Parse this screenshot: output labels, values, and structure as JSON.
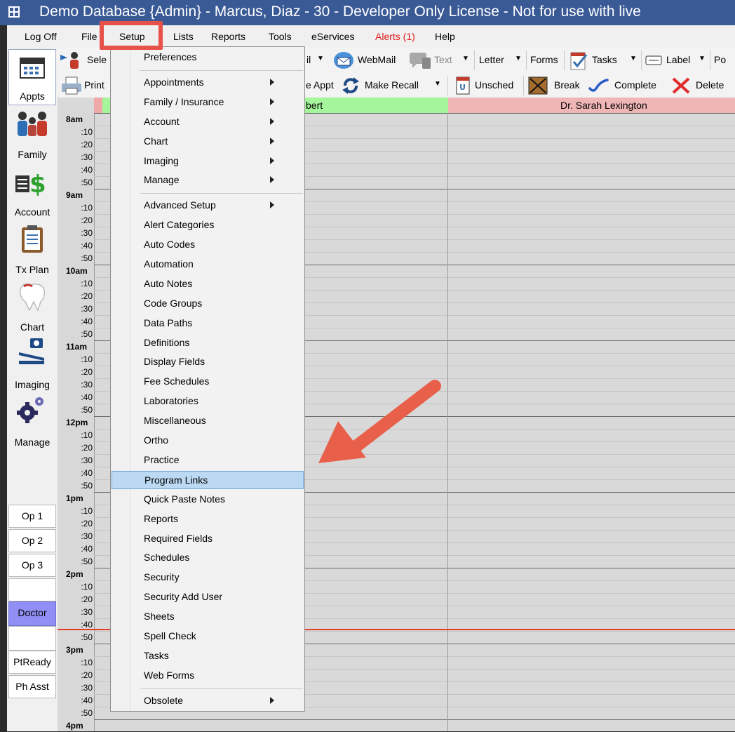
{
  "window": {
    "title": "Demo Database {Admin} - Marcus, Diaz - 30 - Developer Only License - Not for use with live"
  },
  "menubar": {
    "items": [
      "Log Off",
      "File",
      "Setup",
      "Lists",
      "Reports",
      "Tools",
      "eServices",
      "Alerts (1)",
      "Help"
    ],
    "alerts_color": "#e31b1b"
  },
  "toolbar1": {
    "select": "Sele",
    "mail": "il",
    "webmail": "WebMail",
    "text": "Text",
    "letter": "Letter",
    "forms": "Forms",
    "tasks": "Tasks",
    "label": "Label",
    "po": "Po"
  },
  "toolbar2": {
    "print": "Print",
    "appt": "e Appt",
    "make_recall": "Make Recall",
    "unsched": "Unsched",
    "break": "Break",
    "complete": "Complete",
    "delete": "Delete"
  },
  "rail": {
    "modules": [
      "Appts",
      "Family",
      "Account",
      "Tx Plan",
      "Chart",
      "Imaging",
      "Manage"
    ],
    "ops": [
      "Op 1",
      "Op 2",
      "Op 3"
    ],
    "doctor": "Doctor",
    "ptready": "PtReady",
    "phasst": "Ph Asst"
  },
  "schedule": {
    "provider1": "bert",
    "provider2": "Dr. Sarah Lexington",
    "provider1_color": "#a5f59a",
    "provider2_color": "#f0b6b6",
    "times": [
      "8am",
      ":10",
      ":20",
      ":30",
      ":40",
      ":50",
      "9am",
      ":10",
      ":20",
      ":30",
      ":40",
      ":50",
      "10am",
      ":10",
      ":20",
      ":30",
      ":40",
      ":50",
      "11am",
      ":10",
      ":20",
      ":30",
      ":40",
      ":50",
      "12pm",
      ":10",
      ":20",
      ":30",
      ":40",
      ":50",
      "1pm",
      ":10",
      ":20",
      ":30",
      ":40",
      ":50",
      "2pm",
      ":10",
      ":20",
      ":30",
      ":40",
      ":50",
      "3pm",
      ":10",
      ":20",
      ":30",
      ":40",
      ":50",
      "4pm"
    ],
    "timeline_color": "#e53b2a"
  },
  "setup_menu": {
    "items": [
      {
        "label": "Preferences",
        "submenu": false
      },
      {
        "label": "Appointments",
        "submenu": true
      },
      {
        "label": "Family / Insurance",
        "submenu": true
      },
      {
        "label": "Account",
        "submenu": true
      },
      {
        "label": "Chart",
        "submenu": true
      },
      {
        "label": "Imaging",
        "submenu": true
      },
      {
        "label": "Manage",
        "submenu": true
      },
      {
        "label": "Advanced Setup",
        "submenu": true
      },
      {
        "label": "Alert Categories",
        "submenu": false
      },
      {
        "label": "Auto Codes",
        "submenu": false
      },
      {
        "label": "Automation",
        "submenu": false
      },
      {
        "label": "Auto Notes",
        "submenu": false
      },
      {
        "label": "Code Groups",
        "submenu": false
      },
      {
        "label": "Data Paths",
        "submenu": false
      },
      {
        "label": "Definitions",
        "submenu": false
      },
      {
        "label": "Display Fields",
        "submenu": false
      },
      {
        "label": "Fee Schedules",
        "submenu": false
      },
      {
        "label": "Laboratories",
        "submenu": false
      },
      {
        "label": "Miscellaneous",
        "submenu": false
      },
      {
        "label": "Ortho",
        "submenu": false
      },
      {
        "label": "Practice",
        "submenu": false
      },
      {
        "label": "Program Links",
        "submenu": false,
        "highlighted": true
      },
      {
        "label": "Quick Paste Notes",
        "submenu": false
      },
      {
        "label": "Reports",
        "submenu": false
      },
      {
        "label": "Required Fields",
        "submenu": false
      },
      {
        "label": "Schedules",
        "submenu": false
      },
      {
        "label": "Security",
        "submenu": false
      },
      {
        "label": "Security Add User",
        "submenu": false
      },
      {
        "label": "Sheets",
        "submenu": false
      },
      {
        "label": "Spell Check",
        "submenu": false
      },
      {
        "label": "Tasks",
        "submenu": false
      },
      {
        "label": "Web Forms",
        "submenu": false
      },
      {
        "label": "Obsolete",
        "submenu": true
      }
    ]
  },
  "annotation": {
    "highlight_color": "#e8504a",
    "arrow_color": "#e8604a"
  }
}
